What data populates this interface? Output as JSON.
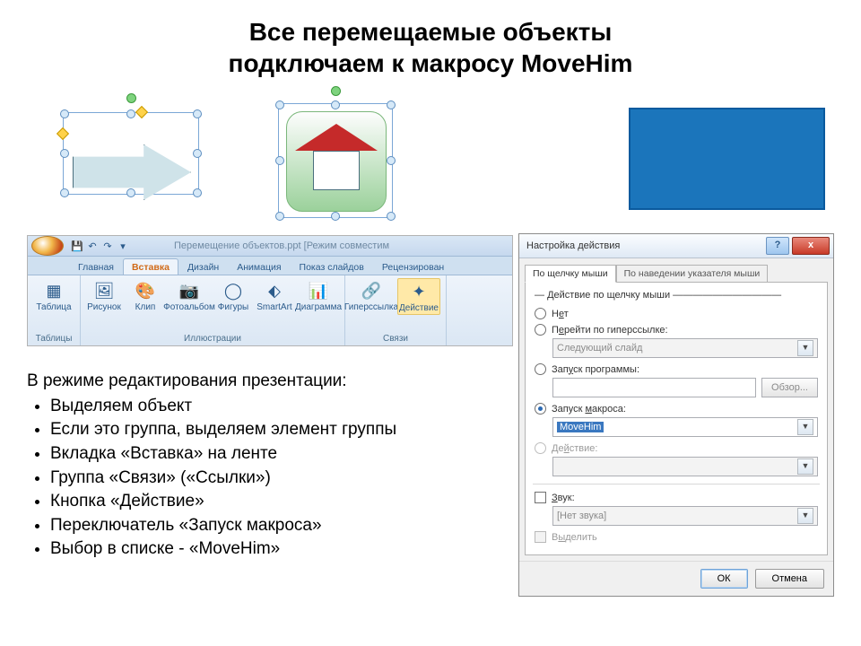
{
  "title_line1": "Все перемещаемые объекты",
  "title_line2": "подключаем к макросу MoveHim",
  "ribbon": {
    "qat_save": "💾",
    "doc_title": "Перемещение объектов.ppt [Режим совместим",
    "tabs": {
      "home": "Главная",
      "insert": "Вставка",
      "design": "Дизайн",
      "anim": "Анимация",
      "show": "Показ слайдов",
      "review": "Рецензирован"
    },
    "grp_tables": "Таблицы",
    "grp_illu": "Иллюстрации",
    "grp_links": "Связи",
    "btn_table": "Таблица",
    "btn_pic": "Рисунок",
    "btn_clip": "Клип",
    "btn_album": "Фотоальбом",
    "btn_shapes": "Фигуры",
    "btn_smartart": "SmartArt",
    "btn_chart": "Диаграмма",
    "btn_hyperlink": "Гиперссылка",
    "btn_action": "Действие"
  },
  "instr": {
    "heading": "В режиме редактирования презентации:",
    "i1": "Выделяем объект",
    "i2": "Если это группа, выделяем элемент группы",
    "i3": "Вкладка «Вставка» на ленте",
    "i4": "Группа «Связи» («Ссылки»)",
    "i5": "Кнопка «Действие»",
    "i6": "Переключатель «Запуск макроса»",
    "i7": "Выбор в списке - «MoveHim»"
  },
  "dialog": {
    "title": "Настройка действия",
    "help": "?",
    "close": "x",
    "tab_click": "По щелчку мыши",
    "tab_hover": "По наведении указателя мыши",
    "frame": "Действие по щелчку мыши",
    "r_none_pre": "Н",
    "r_none_u": "е",
    "r_none_post": "т",
    "r_link_pre": "П",
    "r_link_u": "е",
    "r_link_post": "рейти по гиперссылке:",
    "link_value": "Следующий слайд",
    "r_run_pre": "Зап",
    "r_run_u": "у",
    "r_run_post": "ск программы:",
    "browse": "Обзор...",
    "r_macro": "Запуск ",
    "r_macro_u": "м",
    "r_macro_post": "акроса:",
    "macro_value": "MoveHim",
    "r_action_pre": "Де",
    "r_action_u": "й",
    "r_action_post": "ствие:",
    "sound_pre": "",
    "sound_u": "З",
    "sound_post": "вук:",
    "sound_value": "[Нет звука]",
    "highlight_pre": "В",
    "highlight_u": "ы",
    "highlight_post": "делить",
    "ok": "ОК",
    "cancel": "Отмена"
  }
}
